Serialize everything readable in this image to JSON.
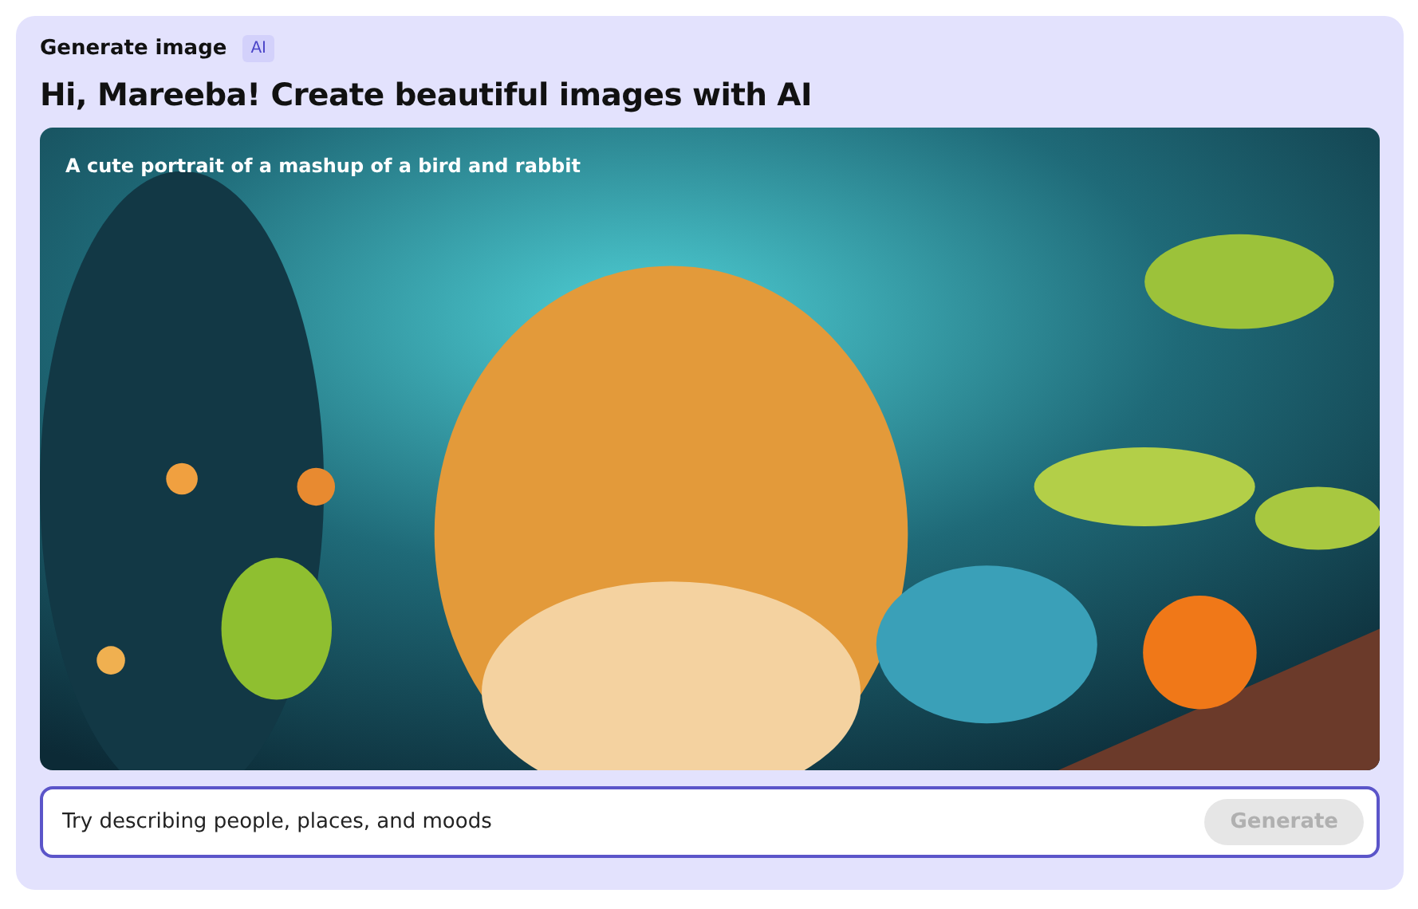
{
  "header": {
    "title": "Generate image",
    "badge": "AI"
  },
  "heading": "Hi, Mareeba! Create beautiful images with AI",
  "image": {
    "kind": "picture",
    "caption": "A cute portrait of a mashup of a bird and rabbit"
  },
  "prompt": {
    "placeholder": "Try describing people, places, and moods"
  },
  "generate_button": {
    "label": "Generate",
    "disabled": true
  }
}
